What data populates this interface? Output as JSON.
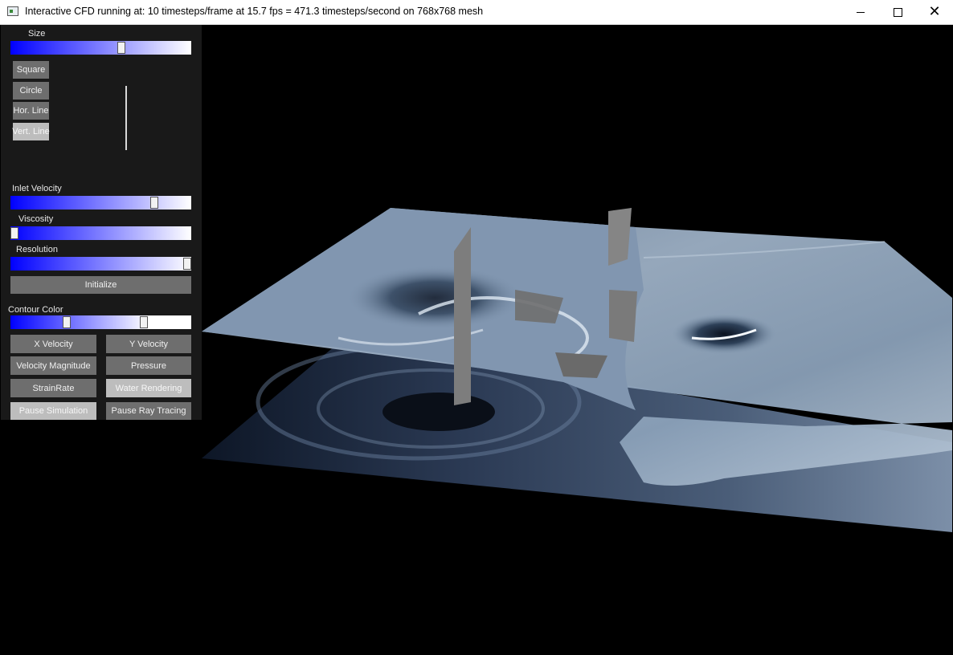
{
  "window": {
    "title": "Interactive CFD running at: 10 timesteps/frame at 15.7 fps = 471.3 timesteps/second on 768x768 mesh"
  },
  "panel": {
    "size_label": "Size",
    "size_value": 0.62,
    "shapes": [
      "Square",
      "Circle",
      "Hor. Line",
      "Vert. Line"
    ],
    "inlet_label": "Inlet Velocity",
    "inlet_value": 0.81,
    "viscosity_label": "Viscosity",
    "viscosity_value": 0.0,
    "resolution_label": "Resolution",
    "resolution_value": 1.0,
    "initialize_label": "Initialize",
    "contour_label": "Contour Color",
    "contour_min": 0.3,
    "contour_max": 0.75,
    "buttons": {
      "x_velocity": "X Velocity",
      "y_velocity": "Y Velocity",
      "velocity_magnitude": "Velocity Magnitude",
      "pressure": "Pressure",
      "strainrate": "StrainRate",
      "water_rendering": "Water Rendering",
      "pause_simulation": "Pause Simulation",
      "pause_ray_tracing": "Pause Ray Tracing"
    }
  },
  "colors": {
    "slider_start": "#0000ff",
    "slider_end": "#ffffff",
    "panel_bg": "#191919",
    "button_bg": "#6e6e6e",
    "button_active_bg": "#bdbdbd"
  }
}
